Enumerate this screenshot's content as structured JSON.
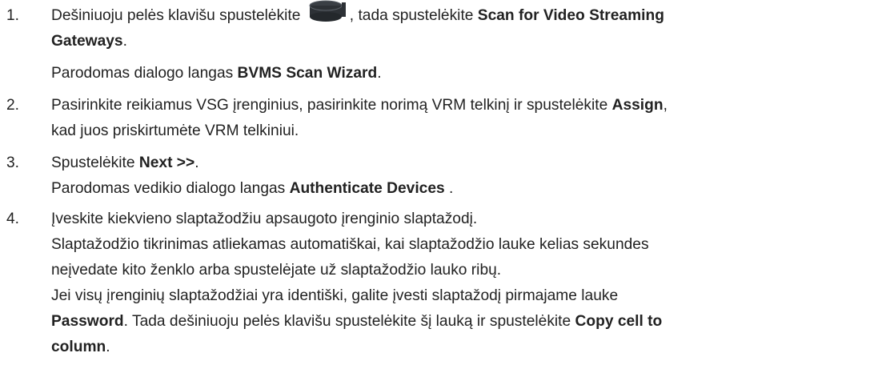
{
  "steps": [
    {
      "number": "1.",
      "line1_prefix": "Dešiniuoju pelės klavišu spustelėkite",
      "icon": "server-device-icon",
      "line1_middle": ", tada spustelėkite ",
      "line1_bold": "Scan for Video Streaming",
      "line2_bold": "Gateways",
      "line2_suffix": ".",
      "line3_prefix": "Parodomas dialogo langas ",
      "line3_bold": "BVMS Scan Wizard",
      "line3_suffix": "."
    },
    {
      "number": "2.",
      "line1_prefix": "Pasirinkite reikiamus VSG įrenginius, pasirinkite norimą VRM telkinį ir spustelėkite ",
      "line1_bold": "Assign",
      "line1_suffix": ",",
      "line2": "kad juos priskirtumėte VRM telkiniui."
    },
    {
      "number": "3.",
      "line1_prefix": "Spustelėkite ",
      "line1_bold": "Next >>",
      "line1_suffix": ".",
      "line2_prefix": "Parodomas vedikio dialogo langas ",
      "line2_bold": "Authenticate Devices",
      "line2_suffix": " ."
    },
    {
      "number": "4.",
      "line1": "Įveskite kiekvieno slaptažodžiu apsaugoto įrenginio slaptažodį.",
      "line2": "Slaptažodžio tikrinimas atliekamas automatiškai, kai slaptažodžio lauke kelias sekundes",
      "line3": "neįvedate kito ženklo arba spustelėjate už slaptažodžio lauko ribų.",
      "line4": "Jei visų įrenginių slaptažodžiai yra identiški, galite įvesti slaptažodį pirmajame lauke",
      "line5_bold": "Password",
      "line5_middle": ". Tada dešiniuoju pelės klavišu spustelėkite šį lauką ir spustelėkite ",
      "line5_bold2": "Copy cell to",
      "line6_bold": "column",
      "line6_suffix": "."
    }
  ]
}
